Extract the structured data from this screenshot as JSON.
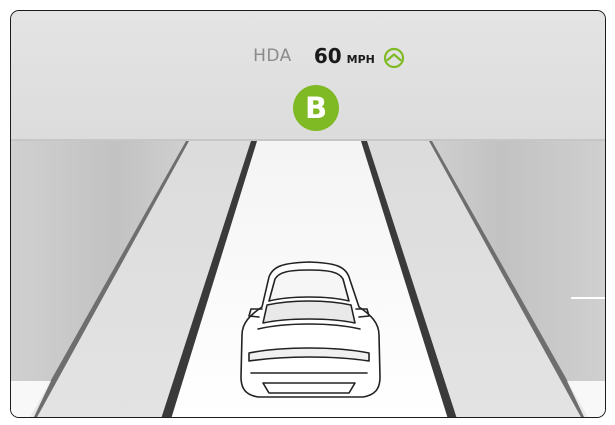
{
  "hud": {
    "mode_label": "HDA",
    "speed_value": "60",
    "speed_unit": "MPH",
    "icon": "steering-wheel-icon",
    "badge_letter": "B"
  },
  "colors": {
    "accent_green": "#7fba24",
    "text_dark": "#1a1a1a",
    "text_muted": "#8a8a8a"
  }
}
